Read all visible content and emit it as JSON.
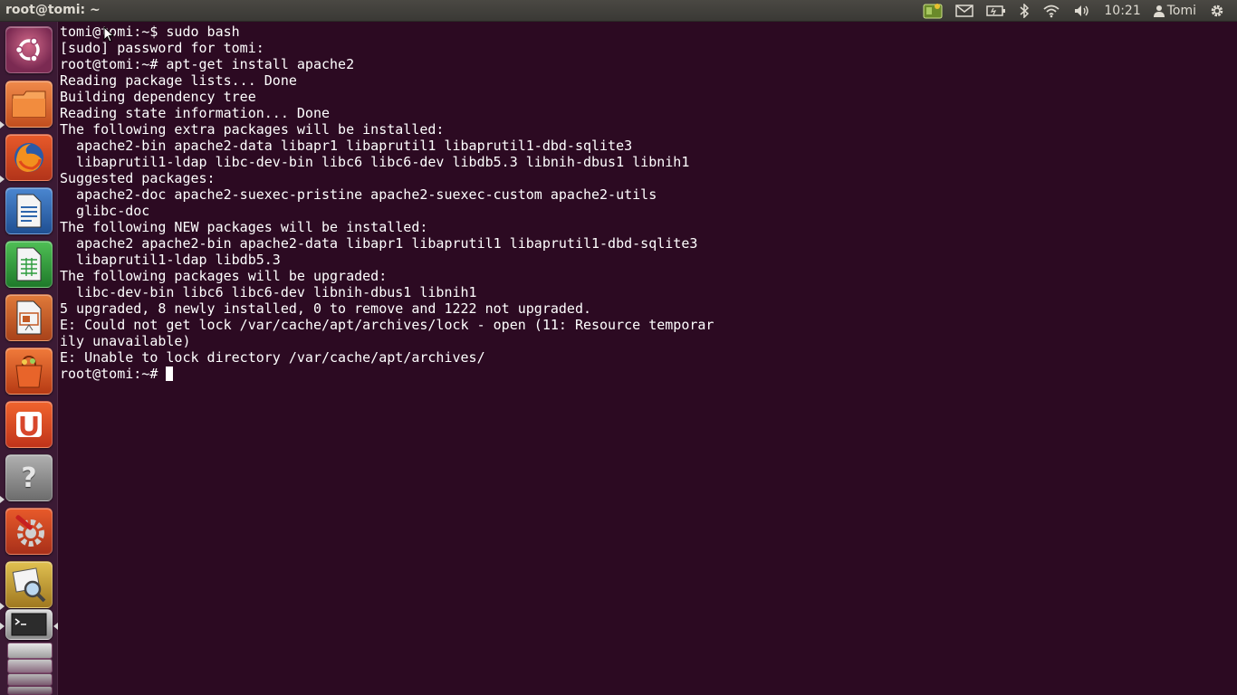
{
  "topbar": {
    "window_title": "root@tomi: ~",
    "indicators": [
      {
        "name": "update-icon"
      },
      {
        "name": "mail-icon"
      },
      {
        "name": "battery-icon"
      },
      {
        "name": "bluetooth-icon"
      },
      {
        "name": "wifi-icon"
      },
      {
        "name": "volume-icon"
      }
    ],
    "clock": "10:21",
    "user": "Tomi",
    "power_icon": "gear-icon"
  },
  "launcher": {
    "items": [
      {
        "name": "dash-home-icon",
        "color": "#e25b36"
      },
      {
        "name": "files-icon",
        "color": "#e8793a"
      },
      {
        "name": "firefox-icon",
        "color": "#d9532a"
      },
      {
        "name": "writer-icon",
        "color": "#2e66ad"
      },
      {
        "name": "calc-icon",
        "color": "#2d9b3c"
      },
      {
        "name": "impress-icon",
        "color": "#c35a24"
      },
      {
        "name": "software-center-icon",
        "color": "#d7502a"
      },
      {
        "name": "ubuntu-one-icon",
        "color": "#d8472c"
      },
      {
        "name": "help-icon",
        "color": "#8a8a8a"
      },
      {
        "name": "system-settings-icon",
        "color": "#c4441f"
      },
      {
        "name": "image-viewer-icon",
        "color": "#c99b2c"
      },
      {
        "name": "terminal-icon",
        "color": "#5a5a5a"
      },
      {
        "name": "workspaces-icon",
        "color": "#8a4a7a"
      }
    ]
  },
  "terminal": {
    "lines": [
      "tomi@tomi:~$ sudo bash",
      "[sudo] password for tomi:",
      "root@tomi:~# apt-get install apache2",
      "Reading package lists... Done",
      "Building dependency tree",
      "Reading state information... Done",
      "The following extra packages will be installed:",
      "  apache2-bin apache2-data libapr1 libaprutil1 libaprutil1-dbd-sqlite3",
      "  libaprutil1-ldap libc-dev-bin libc6 libc6-dev libdb5.3 libnih-dbus1 libnih1",
      "Suggested packages:",
      "  apache2-doc apache2-suexec-pristine apache2-suexec-custom apache2-utils",
      "  glibc-doc",
      "The following NEW packages will be installed:",
      "  apache2 apache2-bin apache2-data libapr1 libaprutil1 libaprutil1-dbd-sqlite3",
      "  libaprutil1-ldap libdb5.3",
      "The following packages will be upgraded:",
      "  libc-dev-bin libc6 libc6-dev libnih-dbus1 libnih1",
      "5 upgraded, 8 newly installed, 0 to remove and 1222 not upgraded.",
      "E: Could not get lock /var/cache/apt/archives/lock - open (11: Resource temporar",
      "ily unavailable)",
      "E: Unable to lock directory /var/cache/apt/archives/"
    ],
    "prompt": "root@tomi:~# "
  }
}
